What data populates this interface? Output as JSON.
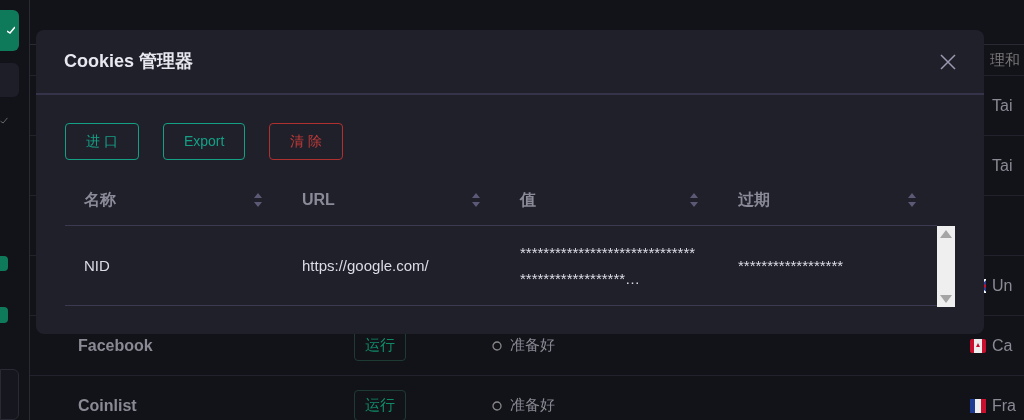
{
  "background": {
    "header_text": "理和",
    "rows": [
      {
        "country": "Tai",
        "kind": "plain"
      },
      {
        "country": "Tai",
        "kind": "plain"
      },
      {},
      {
        "country": "Un",
        "kind": "uk"
      },
      {
        "name": "Facebook",
        "action": "运行",
        "status": "准备好",
        "country": "Ca",
        "kind": "ca"
      },
      {
        "name": "Coinlist",
        "action": "运行",
        "status": "准备好",
        "country": "Fra",
        "kind": "fr"
      }
    ]
  },
  "dialog": {
    "title": "Cookies 管理器",
    "buttons": [
      {
        "label": "进 口",
        "kind": "primary"
      },
      {
        "label": "Export",
        "kind": "primary"
      },
      {
        "label": "清 除",
        "kind": "danger"
      }
    ],
    "table": {
      "columns": [
        "名称",
        "URL",
        "值",
        "过期"
      ],
      "rows": [
        [
          "NID",
          "https://google.com/",
          "************************************************…",
          "******************"
        ]
      ]
    }
  }
}
